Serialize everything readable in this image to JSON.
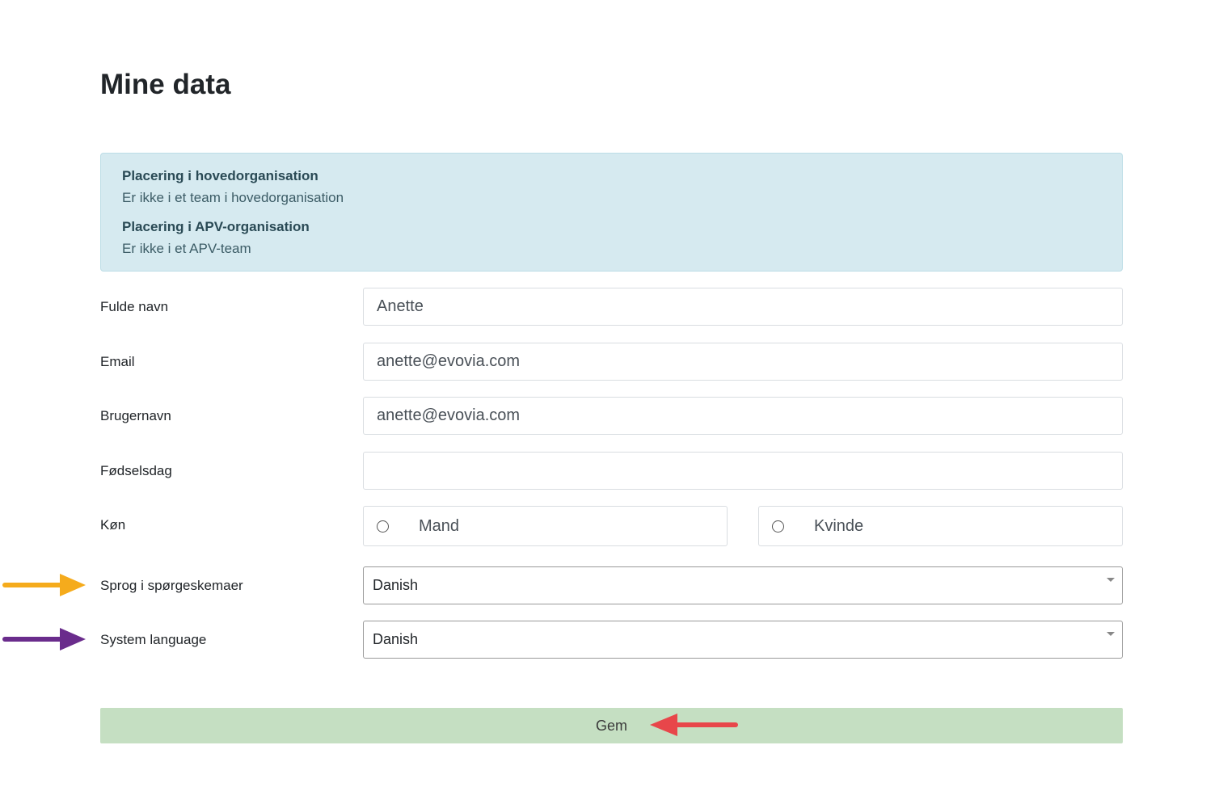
{
  "page": {
    "title": "Mine data"
  },
  "info": {
    "main_org_heading": "Placering i hovedorganisation",
    "main_org_text": "Er ikke i et team i hovedorganisation",
    "apv_org_heading": "Placering i APV-organisation",
    "apv_org_text": "Er ikke i et APV-team"
  },
  "form": {
    "full_name": {
      "label": "Fulde navn",
      "value": "Anette"
    },
    "email": {
      "label": "Email",
      "value": "anette@evovia.com"
    },
    "username": {
      "label": "Brugernavn",
      "value": "anette@evovia.com"
    },
    "birthday": {
      "label": "Fødselsdag",
      "value": ""
    },
    "gender": {
      "label": "Køn",
      "option_male": "Mand",
      "option_female": "Kvinde"
    },
    "survey_language": {
      "label": "Sprog i spørgeskemaer",
      "selected": "Danish"
    },
    "system_language": {
      "label": "System language",
      "selected": "Danish"
    },
    "save_label": "Gem"
  },
  "annotations": {
    "arrow_survey_color": "#f5ab1c",
    "arrow_system_color": "#6a2c8c",
    "arrow_save_color": "#e8464a"
  }
}
